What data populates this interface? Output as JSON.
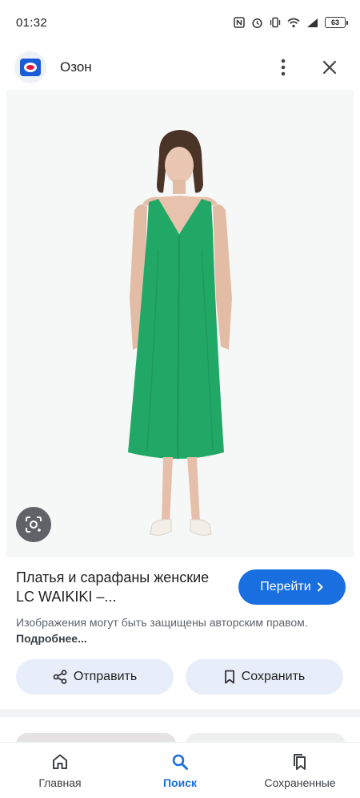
{
  "status_bar": {
    "time": "01:32",
    "battery": "63",
    "icons": [
      "nfc-icon",
      "vibrate-icon",
      "wifi-icon",
      "signal-icon",
      "battery-icon"
    ]
  },
  "header": {
    "app_name": "Озон",
    "menu_icon": "more-vert-icon",
    "close_icon": "close-icon"
  },
  "result": {
    "title": "Платья и сарафаны женские LC WAIKIKI –...",
    "visit_button": "Перейти",
    "copyright_text": "Изображения могут быть защищены авторским правом.",
    "more_link": "Подробнее..."
  },
  "actions": {
    "share": "Отправить",
    "save": "Сохранить"
  },
  "bottom_nav": {
    "items": [
      {
        "label": "Главная",
        "icon": "home-icon"
      },
      {
        "label": "Поиск",
        "icon": "search-icon"
      },
      {
        "label": "Сохраненные",
        "icon": "bookmarks-icon"
      }
    ]
  },
  "colors": {
    "accent": "#1a6fe0",
    "chip_background": "#e8eef9",
    "dress": "#22a866"
  }
}
